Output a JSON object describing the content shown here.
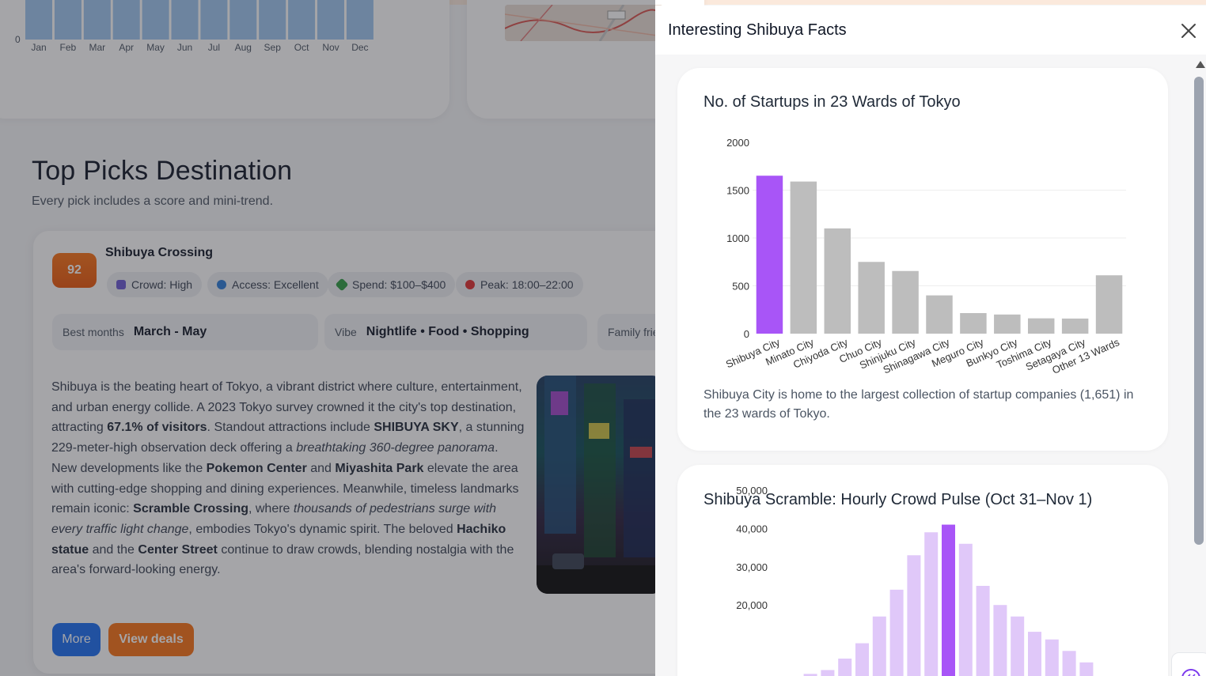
{
  "background": {
    "monthly_chart": {
      "zero_label": "0",
      "months": [
        "Jan",
        "Feb",
        "Mar",
        "Apr",
        "May",
        "Jun",
        "Jul",
        "Aug",
        "Sep",
        "Oct",
        "Nov",
        "Dec"
      ]
    },
    "section": {
      "title": "Top Picks Destination",
      "subtitle": "Every pick includes a score and mini-trend."
    },
    "destination": {
      "score": "92",
      "name": "Shibuya Crossing",
      "chips": [
        {
          "icon": "people-icon",
          "text": "Crowd: High"
        },
        {
          "icon": "globe-icon",
          "text": "Access: Excellent"
        },
        {
          "icon": "money-icon",
          "text": "Spend: $100–$400"
        },
        {
          "icon": "alarm-clock-icon",
          "text": "Peak: 18:00–22:00"
        }
      ],
      "best_months_label": "Best months",
      "best_months_value": "March - May",
      "vibe_label": "Vibe",
      "vibe_value": "Nightlife • Food • Shopping",
      "family_label": "Family frie",
      "description": {
        "t1": "Shibuya is the beating heart of Tokyo, a vibrant district where culture, entertainment, and urban energy collide. A 2023 Tokyo survey crowned it the city's top destination, attracting ",
        "b1": "67.1% of visitors",
        "t2": ". Standout attractions include ",
        "b2": "SHIBUYA SKY",
        "t3": ", a stunning 229-meter-high observation deck offering a ",
        "i1": "breathtaking 360-degree panorama",
        "t4": ". New developments like the ",
        "b3": "Pokemon Center",
        "t5": " and ",
        "b4": "Miyashita Park",
        "t6": " elevate the area with cutting-edge shopping and dining experiences. Meanwhile, timeless landmarks remain iconic: ",
        "b5": "Scramble Crossing",
        "t7": ", where ",
        "i2": "thousands of pedestrians surge with every traffic light change",
        "t8": ", embodies Tokyo's dynamic spirit. The beloved ",
        "b6": "Hachiko statue",
        "t9": " and the ",
        "b7": "Center Street",
        "t10": " continue to draw crowds, blending nostalgia with the area's forward-looking energy."
      },
      "more_button": "More",
      "deals_button": "View deals"
    }
  },
  "drawer": {
    "title": "Interesting Shibuya Facts",
    "close_icon": "close-icon",
    "card1": {
      "title": "No. of Startups in 23 Wards of Tokyo",
      "caption": "Shibuya City is home to the largest collection of startup companies (1,651) in the 23 wards of Tokyo."
    },
    "card2": {
      "title": "Shibuya Scramble: Hourly Crowd Pulse (Oct 31–Nov 1)"
    }
  },
  "colors": {
    "highlight_bar": "#a855f7",
    "grey_bar": "#bdbdbd",
    "light_purple_bar": "#e0c8f9",
    "score_orange": "#ea580c",
    "more_blue": "#1d6ff2"
  },
  "chart_data": [
    {
      "type": "bar",
      "title": "No. of Startups in 23 Wards of Tokyo",
      "categories": [
        "Shibuya City",
        "Minato City",
        "Chiyoda City",
        "Chuo City",
        "Shinjuku City",
        "Shinagawa City",
        "Meguro City",
        "Bunkyo City",
        "Toshima City",
        "Setagaya City",
        "Other 13 Wards"
      ],
      "values": [
        1651,
        1590,
        1100,
        750,
        655,
        400,
        215,
        200,
        160,
        158,
        610
      ],
      "highlight_index": 0,
      "ylim": [
        0,
        2000
      ],
      "yticks": [
        "0",
        "500",
        "1000",
        "1500",
        "2000"
      ],
      "grid": true
    },
    {
      "type": "bar",
      "title": "Shibuya Scramble: Hourly Crowd Pulse (Oct 31–Nov 1)",
      "values": [
        500,
        1000,
        2000,
        3000,
        6000,
        10000,
        17000,
        24000,
        33000,
        39000,
        41000,
        36000,
        25000,
        20000,
        17000,
        13000,
        11000,
        8000,
        5000
      ],
      "highlight_index": 10,
      "ylim": [
        10000,
        50000
      ],
      "yticks": [
        "20,000",
        "30,000",
        "40,000",
        "50,000"
      ],
      "grid": false
    }
  ]
}
